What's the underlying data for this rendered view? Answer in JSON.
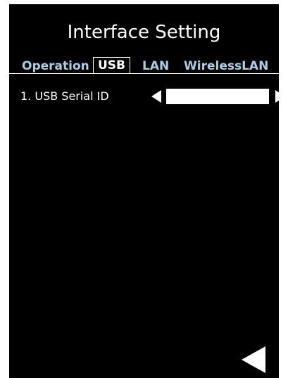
{
  "screen": {
    "title": "Interface Setting",
    "background_color": "#000000",
    "accent_color": "#a9cfe6"
  },
  "tabs": [
    {
      "label": "Operation",
      "active": false
    },
    {
      "label": "USB",
      "active": true
    },
    {
      "label": "LAN",
      "active": false
    },
    {
      "label": "WirelessLAN",
      "active": false
    }
  ],
  "settings": [
    {
      "label": "1. USB Serial ID",
      "value": "",
      "prev_icon": "triangle-left-icon",
      "next_icon": "triangle-right-icon"
    }
  ],
  "footer": {
    "back_icon": "triangle-left-icon"
  }
}
